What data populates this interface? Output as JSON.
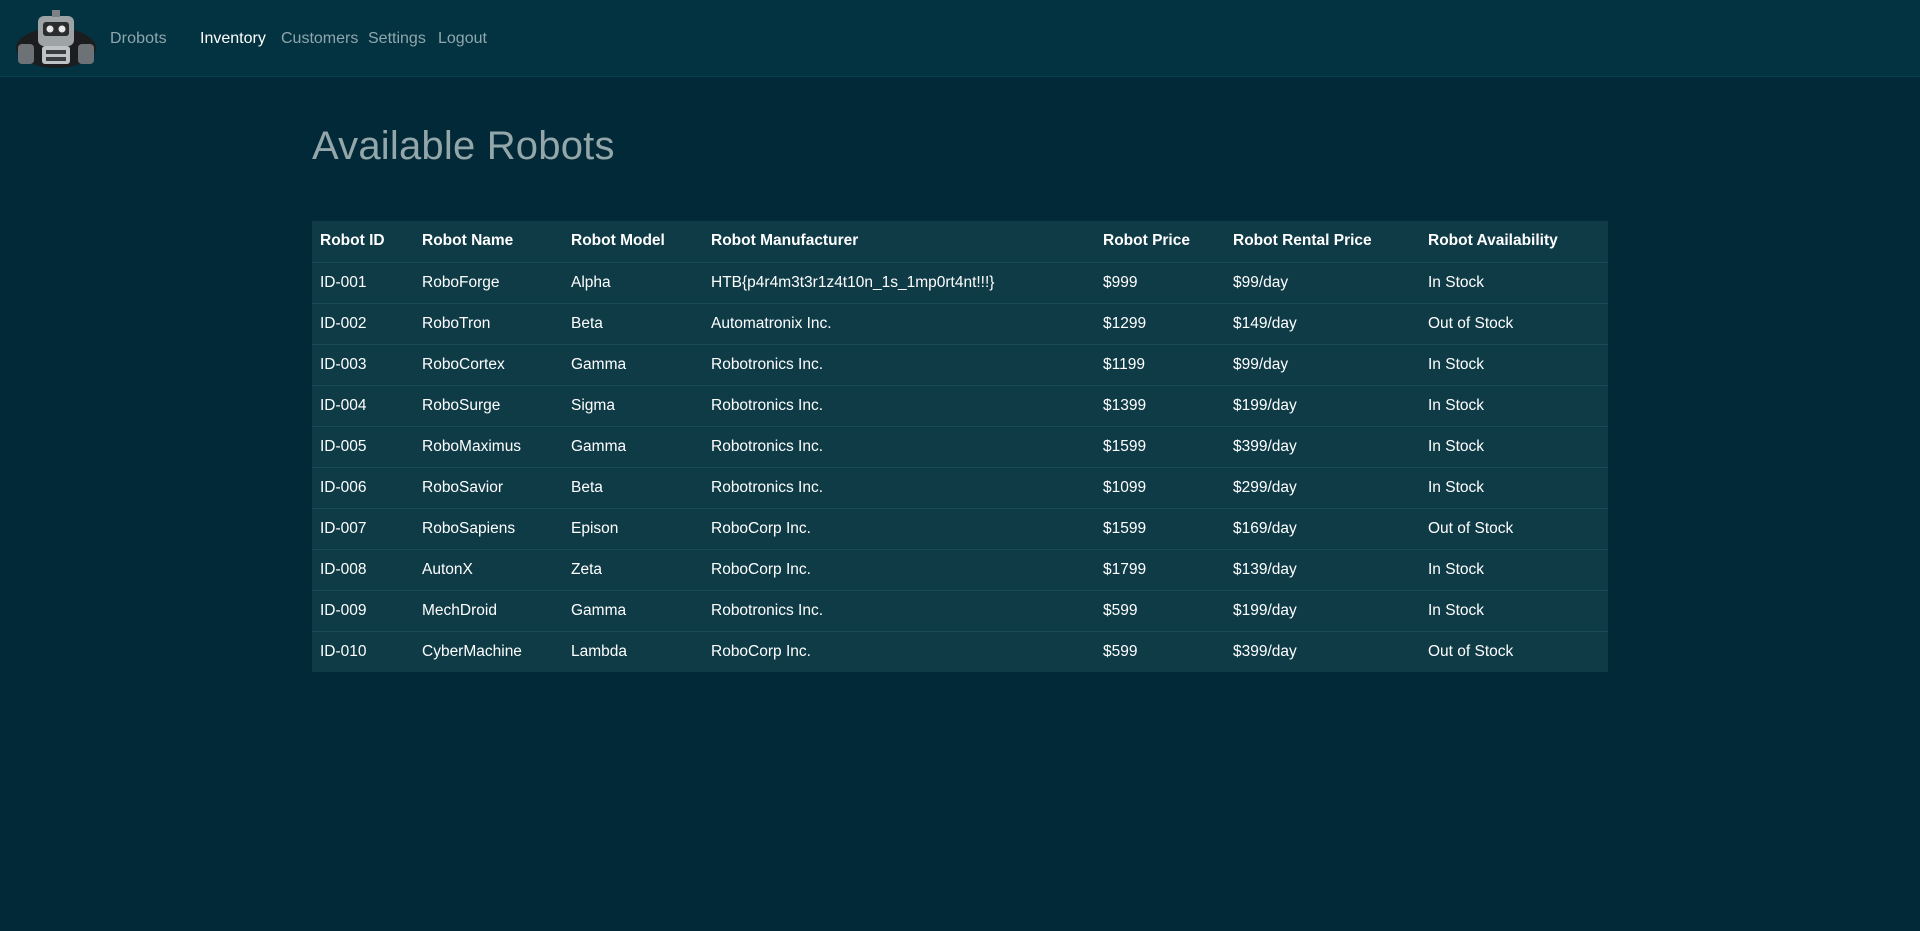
{
  "navbar": {
    "brand": "Drobots",
    "links": [
      {
        "label": "Inventory",
        "active": true
      },
      {
        "label": "Customers",
        "active": false
      },
      {
        "label": "Settings",
        "active": false
      },
      {
        "label": "Logout",
        "active": false
      }
    ]
  },
  "page": {
    "title": "Available Robots"
  },
  "table": {
    "headers": [
      "Robot ID",
      "Robot Name",
      "Robot Model",
      "Robot Manufacturer",
      "Robot Price",
      "Robot Rental Price",
      "Robot Availability"
    ],
    "rows": [
      [
        "ID-001",
        "RoboForge",
        "Alpha",
        "HTB{p4r4m3t3r1z4t10n_1s_1mp0rt4nt!!!}",
        "$999",
        "$99/day",
        "In Stock"
      ],
      [
        "ID-002",
        "RoboTron",
        "Beta",
        "Automatronix Inc.",
        "$1299",
        "$149/day",
        "Out of Stock"
      ],
      [
        "ID-003",
        "RoboCortex",
        "Gamma",
        "Robotronics Inc.",
        "$1199",
        "$99/day",
        "In Stock"
      ],
      [
        "ID-004",
        "RoboSurge",
        "Sigma",
        "Robotronics Inc.",
        "$1399",
        "$199/day",
        "In Stock"
      ],
      [
        "ID-005",
        "RoboMaximus",
        "Gamma",
        "Robotronics Inc.",
        "$1599",
        "$399/day",
        "In Stock"
      ],
      [
        "ID-006",
        "RoboSavior",
        "Beta",
        "Robotronics Inc.",
        "$1099",
        "$299/day",
        "In Stock"
      ],
      [
        "ID-007",
        "RoboSapiens",
        "Epison",
        "RoboCorp Inc.",
        "$1599",
        "$169/day",
        "Out of Stock"
      ],
      [
        "ID-008",
        "AutonX",
        "Zeta",
        "RoboCorp Inc.",
        "$1799",
        "$139/day",
        "In Stock"
      ],
      [
        "ID-009",
        "MechDroid",
        "Gamma",
        "Robotronics Inc.",
        "$599",
        "$199/day",
        "In Stock"
      ],
      [
        "ID-010",
        "CyberMachine",
        "Lambda",
        "RoboCorp Inc.",
        "$599",
        "$399/day",
        "Out of Stock"
      ]
    ]
  },
  "icons": {
    "brand_logo": "robot-logo-icon"
  },
  "colors": {
    "background": "#022937",
    "navbar": "#033341",
    "table": "#0f3b47",
    "title": "#93a6a9",
    "nav_inactive": "#8fa6ad"
  }
}
